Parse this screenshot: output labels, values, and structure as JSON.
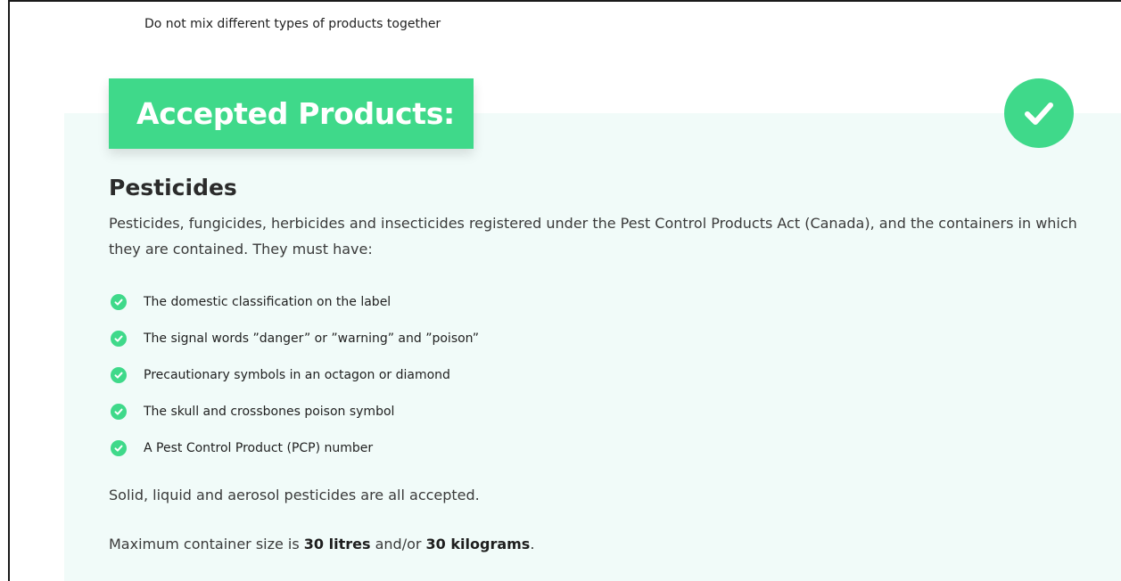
{
  "top_note": "Do not mix different types of products together",
  "accepted": {
    "heading": "Accepted Products:",
    "check_icon": "check-circle-icon",
    "accent_color": "#3fd98a",
    "panel_color": "#f1fbf9"
  },
  "pesticides": {
    "title": "Pesticides",
    "intro": "Pesticides, fungicides, herbicides and insecticides registered under the Pest Control Products Act (Canada), and the containers in which they are contained. They must have:",
    "requirements": [
      "The domestic classification on the label",
      "The signal words ”danger” or ”warning” and ”poison”",
      "Precautionary symbols in an octagon or diamond",
      "The skull and crossbones poison symbol",
      "A Pest Control Product (PCP) number"
    ],
    "accepted_forms": "Solid, liquid and aerosol pesticides are all accepted.",
    "max_size": {
      "prefix": "Maximum container size is ",
      "litres": "30 litres",
      "joiner": " and/or ",
      "kilograms": "30 kilograms",
      "suffix": "."
    }
  }
}
